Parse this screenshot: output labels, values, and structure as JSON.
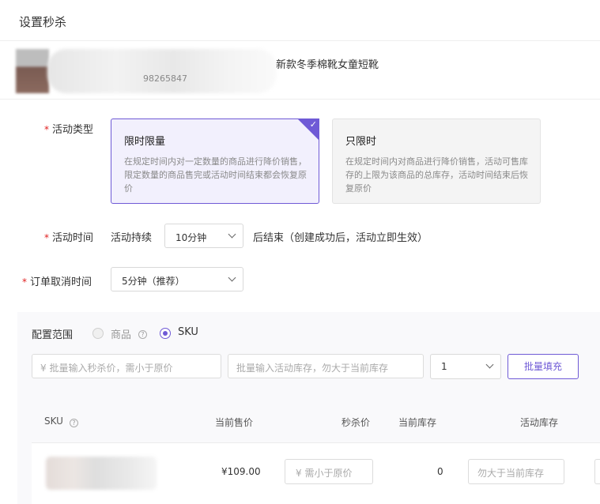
{
  "header": {
    "title": "设置秒杀"
  },
  "product": {
    "name": "新款冬季棉靴女童短靴",
    "id_partial": "98265847"
  },
  "activity_type": {
    "label": "活动类型",
    "options": [
      {
        "title": "限时限量",
        "desc": "在规定时间内对一定数量的商品进行降价销售，限定数量的商品售完或活动时间结束都会恢复原价",
        "selected": true
      },
      {
        "title": "只限时",
        "desc": "在规定时间内对商品进行降价销售，活动可售库存的上限为该商品的总库存，活动时间结束后恢复原价",
        "selected": false
      }
    ]
  },
  "activity_time": {
    "label": "活动时间",
    "prefix": "活动持续",
    "duration_value": "10分钟",
    "suffix": "后结束（创建成功后，活动立即生效）"
  },
  "order_cancel": {
    "label": "订单取消时间",
    "value": "5分钟（推荐）"
  },
  "scope": {
    "label": "配置范围",
    "options": [
      {
        "label": "商品",
        "selected": false,
        "disabled": true
      },
      {
        "label": "SKU",
        "selected": true
      }
    ],
    "price_placeholder": "¥ 批量输入秒杀价，需小于原价",
    "stock_placeholder": "批量输入活动库存，勿大于当前库存",
    "limit_value": "1",
    "fill_button": "批量填充"
  },
  "table": {
    "columns": [
      "SKU",
      "当前售价",
      "秒杀价",
      "当前库存",
      "活动库存"
    ],
    "rows": [
      {
        "price": "¥109.00",
        "flash_price_placeholder": "¥  需小于原价",
        "stock": "0",
        "activity_stock_placeholder": "勿大于当前库存"
      }
    ]
  },
  "colors": {
    "accent": "#6f5ad6",
    "required": "#e02020"
  },
  "icons": {
    "check": "check-icon",
    "help": "help-circle-icon",
    "chevron": "chevron-down-icon"
  }
}
